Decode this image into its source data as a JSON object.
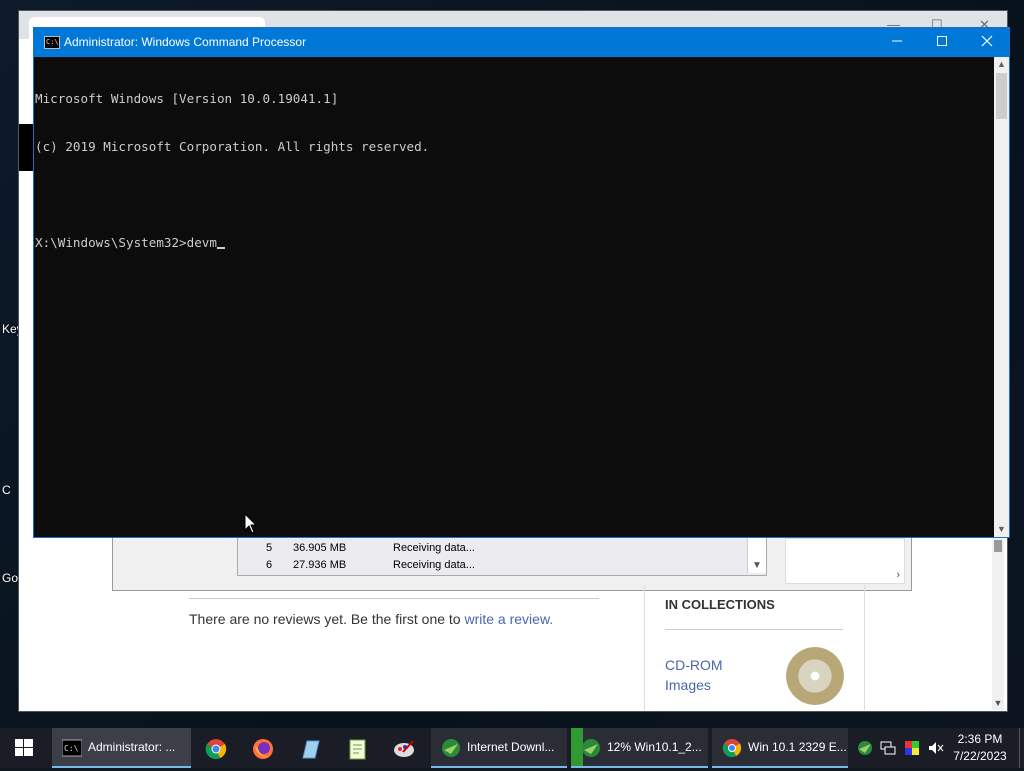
{
  "desktop": {
    "labels": [
      "Key",
      "C",
      "Go"
    ]
  },
  "background_page": {
    "download_rows": [
      {
        "num": "5",
        "size": "36.905 MB",
        "status": "Receiving data..."
      },
      {
        "num": "6",
        "size": "27.936 MB",
        "status": "Receiving data..."
      }
    ],
    "review_text": "There are no reviews yet. Be the first one to ",
    "review_link": "write a review.",
    "collections_title": "IN COLLECTIONS",
    "collection_link_1": "CD-ROM",
    "collection_link_2": "Images"
  },
  "cmd": {
    "title": "Administrator: Windows Command Processor",
    "icon_text": "C:\\",
    "lines": [
      "Microsoft Windows [Version 10.0.19041.1]",
      "(c) 2019 Microsoft Corporation. All rights reserved.",
      "",
      "X:\\Windows\\System32>devm"
    ],
    "minimize_icon": "minimize-icon",
    "maximize_icon": "maximize-icon",
    "close_icon": "close-icon"
  },
  "taskbar": {
    "tasks": [
      {
        "label": "Administrator: ...",
        "icon": "cmd-icon"
      },
      {
        "label": "Internet Downl...",
        "icon": "idm-icon"
      },
      {
        "label": "12% Win10.1_2...",
        "icon": "idm-icon"
      },
      {
        "label": "Win 10.1 2329 E...",
        "icon": "chrome-icon"
      }
    ],
    "pinned": [
      "chrome-icon",
      "firefox-icon",
      "notepad-icon",
      "winrar-icon",
      "paint-icon"
    ],
    "clock_time": "2:36 PM",
    "clock_date": "7/22/2023",
    "colors": {
      "taskbar": "#1a1d26",
      "accent": "#76b9ed",
      "titlebar": "#0078d7"
    }
  }
}
